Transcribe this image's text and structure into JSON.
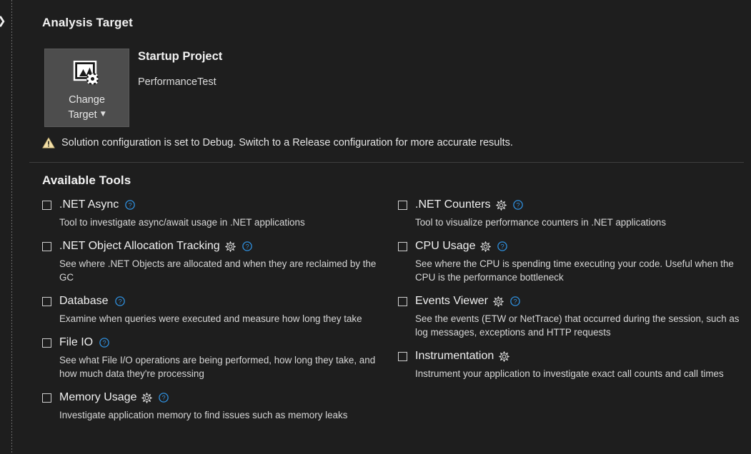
{
  "window": {
    "background_color": "#1e1e1e",
    "accent_color": "#0e8ad8",
    "warning_color": "#f4e0a8"
  },
  "left_rail": {
    "expand_chevron": "❯",
    "expand_chevron_name": "chevron-right-icon"
  },
  "analysis_target": {
    "section_title": "Analysis Target",
    "change_target_button": {
      "label_line1": "Change",
      "label_line2": "Target",
      "caret": "▼",
      "icon": "image-settings-icon"
    },
    "startup_project_heading": "Startup Project",
    "startup_project_name": "PerformanceTest",
    "warning": {
      "icon": "warning-triangle-icon",
      "text": "Solution configuration is set to Debug. Switch to a Release configuration for more accurate results."
    }
  },
  "available_tools": {
    "section_title": "Available Tools",
    "left_column": [
      {
        "name": ".NET Async",
        "description": "Tool to investigate async/await usage in .NET applications",
        "checked": false,
        "has_settings": false,
        "has_help": true
      },
      {
        "name": ".NET Object Allocation Tracking",
        "description": "See where .NET Objects are allocated and when they are reclaimed by the GC",
        "checked": false,
        "has_settings": true,
        "has_help": true
      },
      {
        "name": "Database",
        "description": "Examine when queries were executed and measure how long they take",
        "checked": false,
        "has_settings": false,
        "has_help": true
      },
      {
        "name": "File IO",
        "description": "See what File I/O operations are being performed, how long they take, and how much data they're processing",
        "checked": false,
        "has_settings": false,
        "has_help": true
      },
      {
        "name": "Memory Usage",
        "description": "Investigate application memory to find issues such as memory leaks",
        "checked": false,
        "has_settings": true,
        "has_help": true
      }
    ],
    "right_column": [
      {
        "name": ".NET Counters",
        "description": "Tool to visualize performance counters in .NET applications",
        "checked": false,
        "has_settings": true,
        "has_help": true
      },
      {
        "name": "CPU Usage",
        "description": "See where the CPU is spending time executing your code. Useful when the CPU is the performance bottleneck",
        "checked": false,
        "has_settings": true,
        "has_help": true
      },
      {
        "name": "Events Viewer",
        "description": "See the events (ETW or NetTrace) that occurred during the session, such as log messages, exceptions and HTTP requests",
        "checked": false,
        "has_settings": true,
        "has_help": true
      },
      {
        "name": "Instrumentation",
        "description": "Instrument your application to investigate exact call counts and call times",
        "checked": false,
        "has_settings": true,
        "has_help": false
      }
    ]
  }
}
